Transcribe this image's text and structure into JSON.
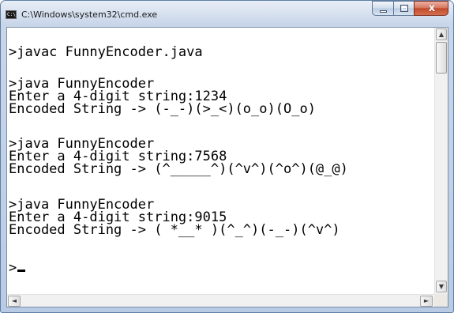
{
  "window": {
    "title": "C:\\Windows\\system32\\cmd.exe",
    "icon_text": "C:\\",
    "close_glyph": "x"
  },
  "console": {
    "lines": [
      ">javac FunnyEncoder.java",
      "",
      ">java FunnyEncoder",
      "Enter a 4-digit string:1234",
      "Encoded String -> (-_-)(>_<)(o_o)(O_o)",
      "",
      ">java FunnyEncoder",
      "Enter a 4-digit string:7568",
      "Encoded String -> (^_____^)(^v^)(^o^)(@_@)",
      "",
      ">java FunnyEncoder",
      "Enter a 4-digit string:9015",
      "Encoded String -> ( *__* )(^_^)(-_-)(^v^)",
      "",
      ">"
    ]
  },
  "scrollbars": {
    "up_arrow": "▲",
    "down_arrow": "▼",
    "left_arrow": "◄",
    "right_arrow": "►"
  }
}
